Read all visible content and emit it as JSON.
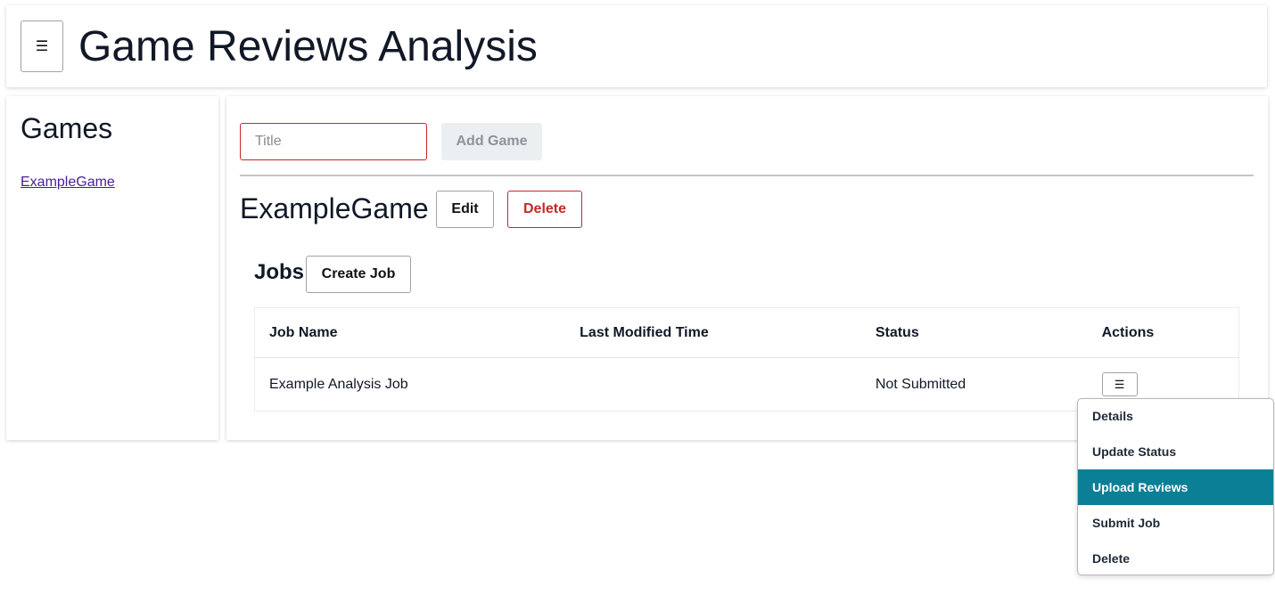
{
  "header": {
    "menu_icon": "☰",
    "title": "Game Reviews Analysis"
  },
  "sidebar": {
    "title": "Games",
    "games": [
      {
        "label": "ExampleGame"
      }
    ]
  },
  "main": {
    "title_input": {
      "placeholder": "Title",
      "value": ""
    },
    "add_game_label": "Add Game",
    "game_title": "ExampleGame",
    "edit_label": "Edit",
    "delete_label": "Delete",
    "jobs": {
      "heading": "Jobs",
      "create_job_label": "Create Job",
      "columns": [
        "Job Name",
        "Last Modified Time",
        "Status",
        "Actions"
      ],
      "rows": [
        {
          "name": "Example Analysis Job",
          "last_modified": "",
          "status": "Not Submitted",
          "actions_icon": "☰"
        }
      ]
    }
  },
  "action_menu": {
    "items": [
      {
        "label": "Details"
      },
      {
        "label": "Update Status"
      },
      {
        "label": "Upload Reviews",
        "highlighted": true
      },
      {
        "label": "Submit Job"
      },
      {
        "label": "Delete"
      }
    ]
  },
  "colors": {
    "accent": "#0b7f95",
    "danger": "#c62828",
    "link": "#4c1d95",
    "disabled_bg": "#eceff1",
    "disabled_text": "#8d939a"
  }
}
